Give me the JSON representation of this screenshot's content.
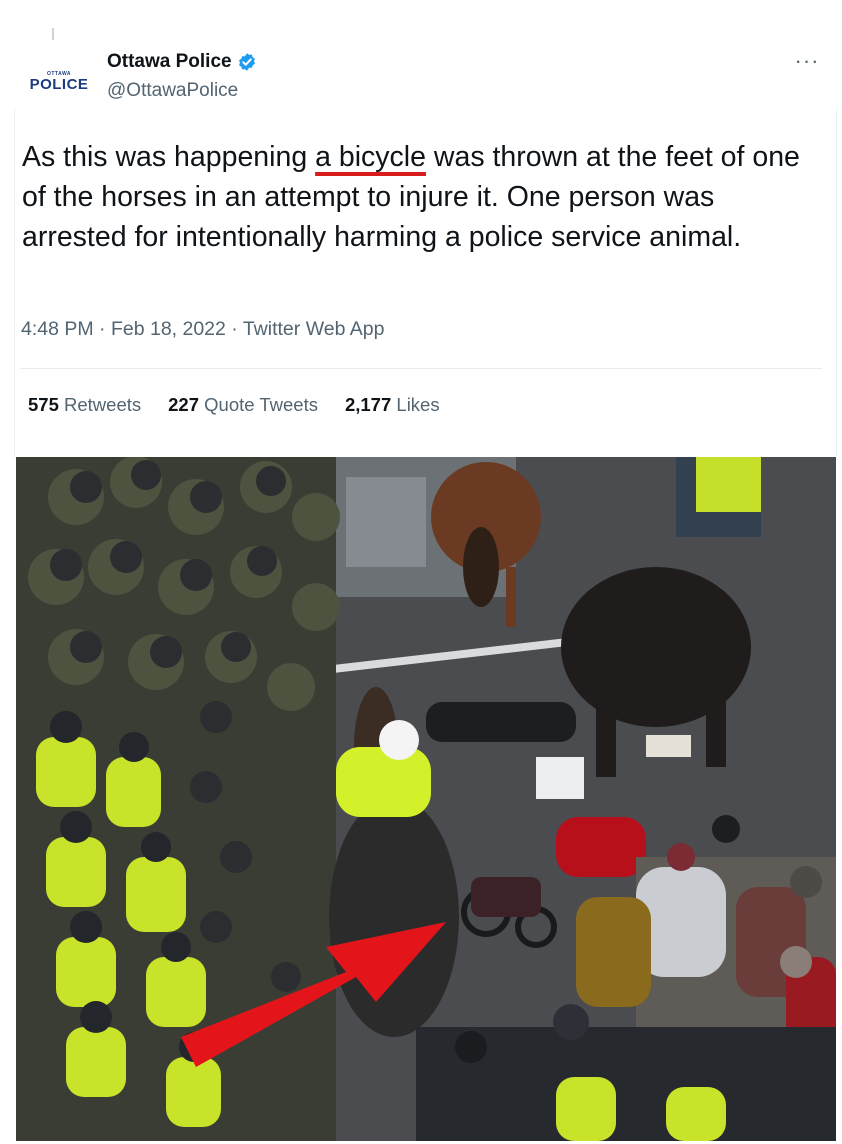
{
  "header": {
    "avatar_small_text": "OTTAWA",
    "avatar_text": "POLICE",
    "display_name": "Ottawa Police",
    "handle": "@OttawaPolice",
    "verified_icon": "verified-badge-icon",
    "more_icon": "more-options-icon"
  },
  "tweet": {
    "text_before": "As this was happening ",
    "text_highlight": "a bicycle",
    "text_after": " was thrown at the feet of one of the horses in an attempt to injure it. One person was arrested for intentionally harming a police service animal.",
    "timestamp": "4:48 PM · Feb 18, 2022 · Twitter Web App"
  },
  "stats": {
    "retweets_count": "575",
    "retweets_label": "Retweets",
    "quotes_count": "227",
    "quotes_label": "Quote Tweets",
    "likes_count": "2,177",
    "likes_label": "Likes"
  },
  "colors": {
    "underline": "#d81b1b",
    "verified": "#1d9bf0",
    "arrow": "#e3141a",
    "hi_vis": "#d4f02a"
  },
  "media": {
    "description_icon": "photo-protest-police-horses",
    "annotation_icon": "red-arrow-icon"
  }
}
